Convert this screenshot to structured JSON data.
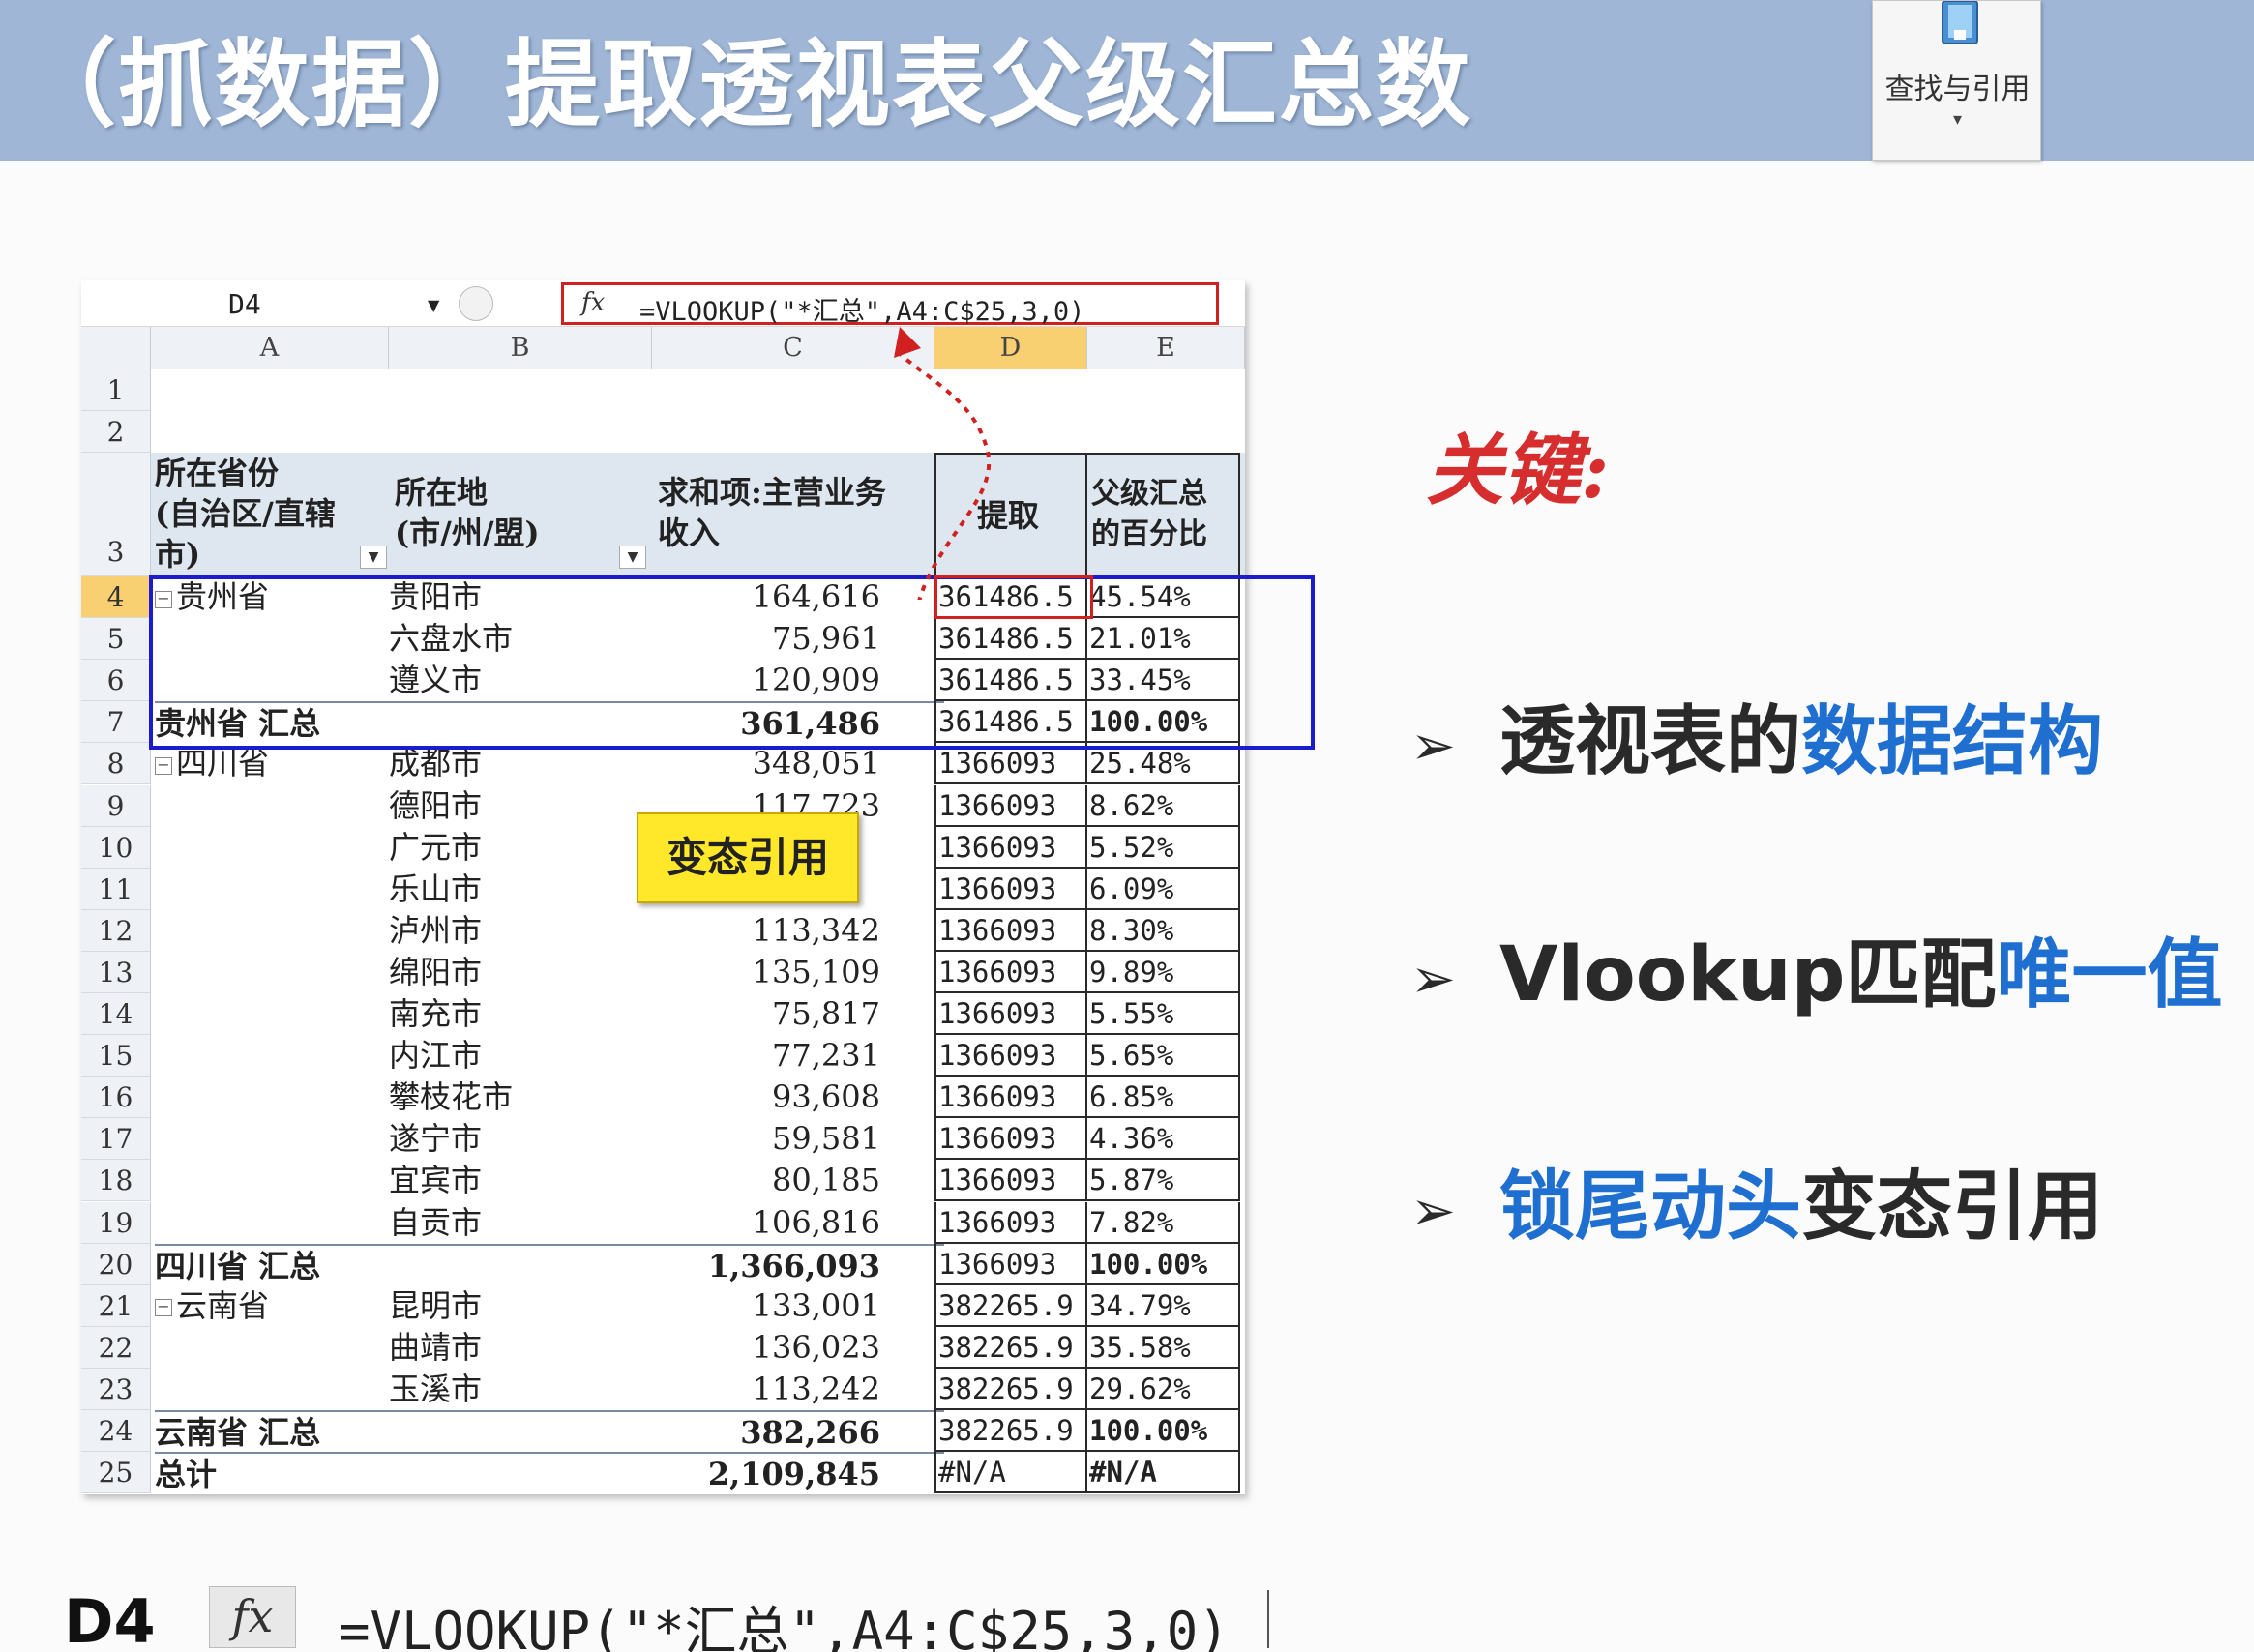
{
  "title": "（抓数据）提取透视表父级汇总数",
  "ribbon": {
    "label": "查找与引用",
    "caret": "▾"
  },
  "formula_bar": {
    "cell_ref": "D4",
    "fx": "fx",
    "formula": "=VLOOKUP(\"*汇总\",A4:C$25,3,0)"
  },
  "columns": [
    "A",
    "B",
    "C",
    "D",
    "E"
  ],
  "header_row": {
    "row": "3",
    "a_lines": [
      "所在省份",
      "(自治区/直辖",
      "市)"
    ],
    "b_lines": [
      "所在地",
      "(市/州/盟)"
    ],
    "c_lines": [
      "求和项:主营业务",
      "收入"
    ],
    "d": "提取",
    "e_lines": [
      "父级汇总",
      "的百分比"
    ]
  },
  "rows": [
    {
      "n": "4",
      "a": "贵州省",
      "expand": true,
      "b": "贵阳市",
      "c": "164,616",
      "d": "361486.5",
      "e": "45.54%"
    },
    {
      "n": "5",
      "a": "",
      "b": "六盘水市",
      "c": "75,961",
      "d": "361486.5",
      "e": "21.01%"
    },
    {
      "n": "6",
      "a": "",
      "b": "遵义市",
      "c": "120,909",
      "d": "361486.5",
      "e": "33.45%"
    },
    {
      "n": "7",
      "a": "贵州省 汇总",
      "b": "",
      "c": "361,486",
      "d": "361486.5",
      "e": "100.00%",
      "total": true
    },
    {
      "n": "8",
      "a": "四川省",
      "expand": true,
      "b": "成都市",
      "c": "348,051",
      "d": "1366093",
      "e": "25.48%"
    },
    {
      "n": "9",
      "a": "",
      "b": "德阳市",
      "c": "117,723",
      "d": "1366093",
      "e": "8.62%"
    },
    {
      "n": "10",
      "a": "",
      "b": "广元市",
      "c": "",
      "d": "1366093",
      "e": "5.52%"
    },
    {
      "n": "11",
      "a": "",
      "b": "乐山市",
      "c": "",
      "d": "1366093",
      "e": "6.09%"
    },
    {
      "n": "12",
      "a": "",
      "b": "泸州市",
      "c": "113,342",
      "d": "1366093",
      "e": "8.30%"
    },
    {
      "n": "13",
      "a": "",
      "b": "绵阳市",
      "c": "135,109",
      "d": "1366093",
      "e": "9.89%"
    },
    {
      "n": "14",
      "a": "",
      "b": "南充市",
      "c": "75,817",
      "d": "1366093",
      "e": "5.55%"
    },
    {
      "n": "15",
      "a": "",
      "b": "内江市",
      "c": "77,231",
      "d": "1366093",
      "e": "5.65%"
    },
    {
      "n": "16",
      "a": "",
      "b": "攀枝花市",
      "c": "93,608",
      "d": "1366093",
      "e": "6.85%"
    },
    {
      "n": "17",
      "a": "",
      "b": "遂宁市",
      "c": "59,581",
      "d": "1366093",
      "e": "4.36%"
    },
    {
      "n": "18",
      "a": "",
      "b": "宜宾市",
      "c": "80,185",
      "d": "1366093",
      "e": "5.87%"
    },
    {
      "n": "19",
      "a": "",
      "b": "自贡市",
      "c": "106,816",
      "d": "1366093",
      "e": "7.82%"
    },
    {
      "n": "20",
      "a": "四川省 汇总",
      "b": "",
      "c": "1,366,093",
      "d": "1366093",
      "e": "100.00%",
      "total": true
    },
    {
      "n": "21",
      "a": "云南省",
      "expand": true,
      "b": "昆明市",
      "c": "133,001",
      "d": "382265.9",
      "e": "34.79%"
    },
    {
      "n": "22",
      "a": "",
      "b": "曲靖市",
      "c": "136,023",
      "d": "382265.9",
      "e": "35.58%"
    },
    {
      "n": "23",
      "a": "",
      "b": "玉溪市",
      "c": "113,242",
      "d": "382265.9",
      "e": "29.62%"
    },
    {
      "n": "24",
      "a": "云南省 汇总",
      "b": "",
      "c": "382,266",
      "d": "382265.9",
      "e": "100.00%",
      "total": true
    },
    {
      "n": "25",
      "a": "总计",
      "b": "",
      "c": "2,109,845",
      "d": "#N/A",
      "e": "#N/A",
      "total": true
    }
  ],
  "callout": "变态引用",
  "key_title": "关键:",
  "bullets": [
    {
      "plain": "透视表的",
      "accent": "数据结构",
      "suffix": ""
    },
    {
      "plain": "Vlookup匹配",
      "accent": "唯一值",
      "suffix": ""
    },
    {
      "plain": "",
      "accent": "锁尾动头",
      "suffix": "变态引用"
    }
  ],
  "bottom": {
    "cell_ref": "D4",
    "fx": "fx",
    "formula": "=VLOOKUP(\"*汇总\",A4:C$25,3,0)"
  },
  "colors": {
    "header_band": "#9fb6d6",
    "accent_blue": "#1f6fd0",
    "highlight_red": "#d02020",
    "frame_blue": "#1c1ccf",
    "callout_yellow": "#ffe82a"
  }
}
